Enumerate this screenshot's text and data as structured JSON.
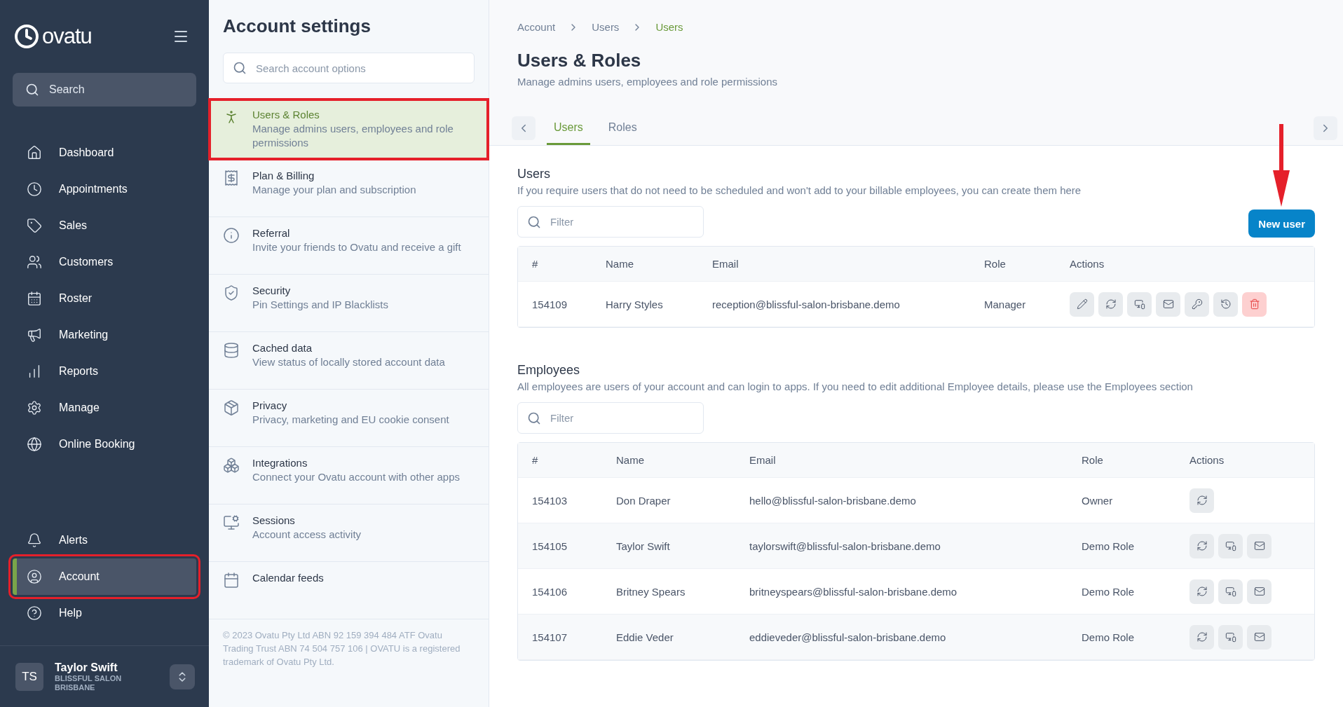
{
  "sidebar": {
    "logo": "ovatu",
    "search": {
      "placeholder": "Search"
    },
    "nav_items": [
      {
        "label": "Dashboard",
        "kind": "home",
        "selected": false
      },
      {
        "label": "Appointments",
        "kind": "clock",
        "selected": false
      },
      {
        "label": "Sales",
        "kind": "tag",
        "selected": false
      },
      {
        "label": "Customers",
        "kind": "users",
        "selected": false
      },
      {
        "label": "Roster",
        "kind": "calendar",
        "selected": false
      },
      {
        "label": "Marketing",
        "kind": "megaphone",
        "selected": false
      },
      {
        "label": "Reports",
        "kind": "chart",
        "selected": false
      },
      {
        "label": "Manage",
        "kind": "cogs",
        "selected": false
      },
      {
        "label": "Online Booking",
        "kind": "globe",
        "selected": false
      }
    ],
    "bottom_items": [
      {
        "label": "Alerts",
        "kind": "bell",
        "selected": false,
        "highlighted": false
      },
      {
        "label": "Account",
        "kind": "account",
        "selected": true,
        "highlighted": true
      },
      {
        "label": "Help",
        "kind": "help",
        "selected": false,
        "highlighted": false
      }
    ],
    "user": {
      "initials": "TS",
      "name": "Taylor Swift",
      "business": "BLISSFUL SALON BRISBANE"
    }
  },
  "settings_panel": {
    "title": "Account settings",
    "search": {
      "placeholder": "Search account options"
    },
    "items": [
      {
        "title": "Users & Roles",
        "description": "Manage admins users, employees and role permissions",
        "kind": "person",
        "selected": true,
        "highlighted": true
      },
      {
        "title": "Plan & Billing",
        "description": "Manage your plan and subscription",
        "kind": "billing",
        "selected": false,
        "highlighted": false
      },
      {
        "title": "Referral",
        "description": "Invite your friends to Ovatu and receive a gift",
        "kind": "info",
        "selected": false,
        "highlighted": false
      },
      {
        "title": "Security",
        "description": "Pin Settings and IP Blacklists",
        "kind": "security",
        "selected": false,
        "highlighted": false
      },
      {
        "title": "Cached data",
        "description": "View status of locally stored account data",
        "kind": "database",
        "selected": false,
        "highlighted": false
      },
      {
        "title": "Privacy",
        "description": "Privacy, marketing and EU cookie consent",
        "kind": "box",
        "selected": false,
        "highlighted": false
      },
      {
        "title": "Integrations",
        "description": "Connect your Ovatu account with other apps",
        "kind": "blocks",
        "selected": false,
        "highlighted": false
      },
      {
        "title": "Sessions",
        "description": "Account access activity",
        "kind": "sessions",
        "selected": false,
        "highlighted": false
      },
      {
        "title": "Calendar feeds",
        "kind": "calendar",
        "selected": false,
        "highlighted": false
      }
    ],
    "footer": "© 2023 Ovatu Pty Ltd ABN 92 159 394 484 ATF Ovatu Trading Trust ABN 74 504 757 106 | OVATU is a registered trademark of Ovatu Pty Ltd."
  },
  "breadcrumb": [
    "Account",
    "Users",
    "Users"
  ],
  "page": {
    "title": "Users & Roles",
    "subtitle": "Manage admins users, employees and role permissions"
  },
  "tabs": [
    {
      "label": "Users",
      "selected": true
    },
    {
      "label": "Roles",
      "selected": false
    }
  ],
  "users_section": {
    "title": "Users",
    "description": "If you require users that do not need to be scheduled and won't add to your billable employees, you can create them here",
    "filter": {
      "placeholder": "Filter"
    },
    "new_user_button": {
      "label": "New user",
      "annotation_arrow": true
    },
    "table": {
      "columns": [
        "#",
        "Name",
        "Email",
        "Role",
        "Actions"
      ],
      "rows": [
        {
          "id": "154109",
          "name": "Harry Styles",
          "email": "reception@blissful-salon-brisbane.demo",
          "role": "Manager",
          "actions": [
            {
              "kind": "edit"
            },
            {
              "kind": "reset"
            },
            {
              "kind": "pin"
            },
            {
              "kind": "email"
            },
            {
              "kind": "keys"
            },
            {
              "kind": "history"
            },
            {
              "kind": "delete"
            }
          ]
        }
      ]
    }
  },
  "employees_section": {
    "title": "Employees",
    "description": "All employees are users of your account and can login to apps. If you need to edit additional Employee details, please use the Employees section",
    "filter": {
      "placeholder": "Filter"
    },
    "table": {
      "columns": [
        "#",
        "Name",
        "Email",
        "Role",
        "Actions"
      ],
      "rows": [
        {
          "id": "154103",
          "name": "Don Draper",
          "email": "hello@blissful-salon-brisbane.demo",
          "role": "Owner",
          "actions": [
            {
              "kind": "reset"
            }
          ]
        },
        {
          "id": "154105",
          "name": "Taylor Swift",
          "email": "taylorswift@blissful-salon-brisbane.demo",
          "role": "Demo Role",
          "actions": [
            {
              "kind": "reset"
            },
            {
              "kind": "pin"
            },
            {
              "kind": "email"
            }
          ]
        },
        {
          "id": "154106",
          "name": "Britney Spears",
          "email": "britneyspears@blissful-salon-brisbane.demo",
          "role": "Demo Role",
          "actions": [
            {
              "kind": "reset"
            },
            {
              "kind": "pin"
            },
            {
              "kind": "email"
            }
          ]
        },
        {
          "id": "154107",
          "name": "Eddie Veder",
          "email": "eddieveder@blissful-salon-brisbane.demo",
          "role": "Demo Role",
          "actions": [
            {
              "kind": "reset"
            },
            {
              "kind": "pin"
            },
            {
              "kind": "email"
            }
          ]
        }
      ]
    }
  }
}
